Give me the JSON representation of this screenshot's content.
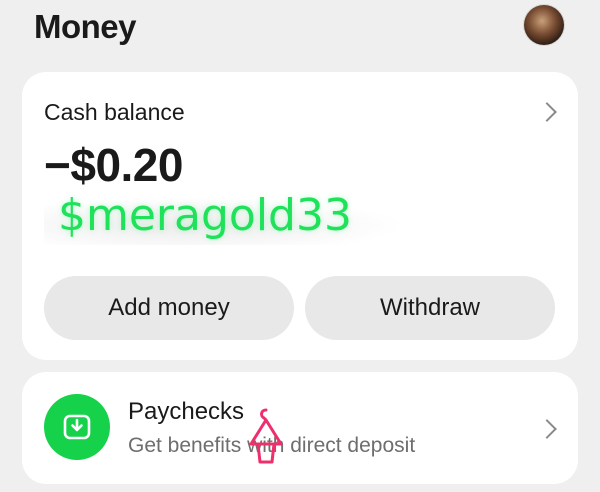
{
  "header": {
    "title": "Money"
  },
  "balance_card": {
    "label": "Cash balance",
    "amount": "−$0.20",
    "cashtag": "$meragold33",
    "add_label": "Add money",
    "withdraw_label": "Withdraw"
  },
  "paychecks": {
    "title": "Paychecks",
    "subtitle": "Get benefits with direct deposit"
  },
  "colors": {
    "accent_green": "#16d14a",
    "cashtag_green": "#1fe15a",
    "watermark_pink": "#ee2f6b"
  },
  "icons": [
    "avatar",
    "chevron-right-icon",
    "download-tray-icon",
    "hanger-icon"
  ]
}
